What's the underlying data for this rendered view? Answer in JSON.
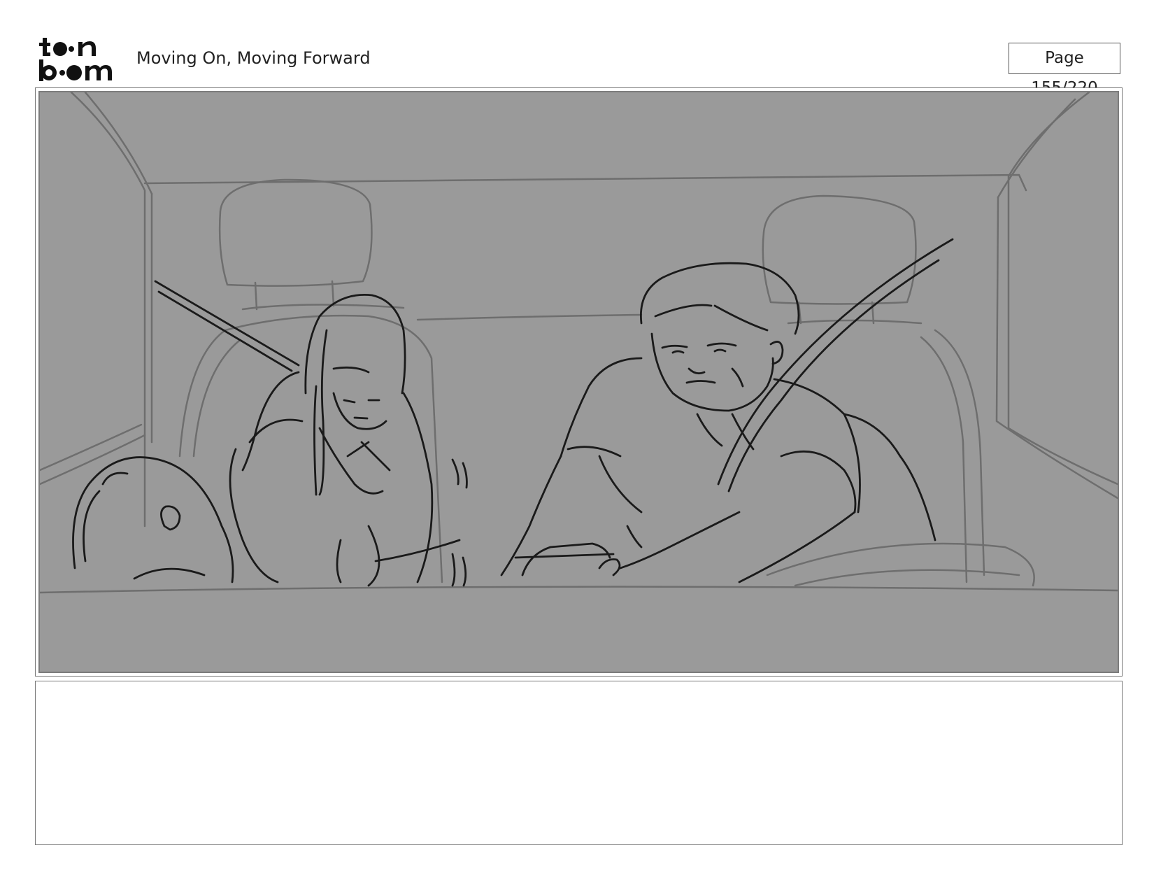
{
  "header": {
    "logo_text": "toon boom",
    "document_title": "Moving On, Moving Forward",
    "page_label": "Page 155/220"
  },
  "panel": {
    "background_color": "#9a9a9a",
    "stroke_color": "#1a1a1a",
    "faint_stroke_color": "#6e6e6e"
  },
  "notes": {
    "text": ""
  }
}
